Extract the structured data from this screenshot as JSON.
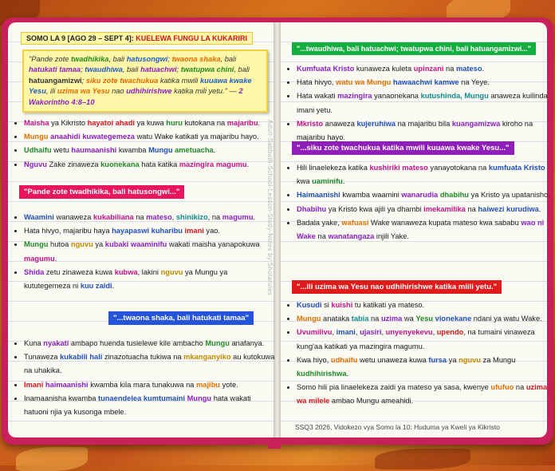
{
  "header": {
    "lesson_tag": "SOMO LA 9 [AGO 29 – SEPT 4]:",
    "lesson_title": "KUELEWA FUNGU LA KUKARIRI"
  },
  "memory_verse": {
    "p1": "\"Pande zote",
    "p2": "twadhikika",
    "p3": ", bali",
    "p4": "hatusongwi",
    "p5": ";",
    "p6": "twaona shaka",
    "p7": ", bali",
    "p8": "hatukati tamaa",
    "p9": ";",
    "p10": "twaudhiwa",
    "p11": ", bali",
    "p12": "hatuachwi",
    "p13": ";",
    "p14": "twatupwa chini",
    "p15": ", bali",
    "p16": "hatuangamizwi",
    "p17": ";",
    "p18": "siku zote twachukua",
    "p19": "katika mwili",
    "p20": "kuuawa kwake Yesu",
    "p21": ", ili",
    "p22": "uzima wa Yesu",
    "p23": "nao",
    "p24": "udhihirishwe",
    "p25": "katika mili yetu.\" —",
    "p26": "2 Wakorintho 4:8–10"
  },
  "left_list_1": [
    {
      "a": "Maisha",
      "b": " ya Kikristo ",
      "c": "hayatoi ahadi",
      "d": " ya kuwa ",
      "e": "huru",
      "f": " kutokana na ",
      "g": "majaribu",
      "h": "."
    },
    {
      "a": "Mungu",
      "b": " ",
      "c": "anaahidi kuwategemeza",
      "d": " watu Wake katikati ya majaribu hayo.",
      "e": "",
      "f": "",
      "g": "",
      "h": ""
    },
    {
      "a": "Udhaifu",
      "b": " wetu ",
      "c": "haumaanishi",
      "d": " kwamba ",
      "e": "Mungu",
      "f": " ",
      "g": "ametuacha",
      "h": "."
    },
    {
      "a": "Nguvu",
      "b": " Zake zinaweza ",
      "c": "kuonekana",
      "d": " hata katika ",
      "e": "mazingira",
      "f": " ",
      "g": "magumu",
      "h": "."
    }
  ],
  "banner_1": "\"Pande zote twadhikika, bali hatusongwi...\"",
  "left_list_2": [
    {
      "a": "Waamini",
      "b": " wanaweza ",
      "c": "kukabiliana",
      "d": " na ",
      "e": "mateso",
      "f": ", ",
      "g": "shinikizo",
      "h": ", na ",
      "i": "magumu",
      "j": "."
    },
    {
      "a": "",
      "b": "Hata hivyo, majaribu haya ",
      "c": "hayapaswi kuharibu",
      "d": " ",
      "e": "imani",
      "f": " yao.",
      "g": "",
      "h": "",
      "i": "",
      "j": ""
    },
    {
      "a": "Mungu",
      "b": " hutoa ",
      "c": "nguvu",
      "d": " ya ",
      "e": "kubaki waaminifu",
      "f": " wakati maisha yanapokuwa ",
      "g": "magumu",
      "h": ".",
      "i": "",
      "j": ""
    },
    {
      "a": "Shida",
      "b": " zetu zinaweza kuwa ",
      "c": "kubwa",
      "d": ", lakini ",
      "e": "nguvu",
      "f": " ya Mungu ya kututegemeza ni ",
      "g": "kuu zaidi",
      "h": ".",
      "i": "",
      "j": ""
    }
  ],
  "banner_2": "\"...twaona shaka, bali hatukati tamaa\"",
  "left_list_3": [
    {
      "a": "",
      "b": "Kuna ",
      "c": "nyakati",
      "d": " ambapo huenda tusielewe kile ambacho ",
      "e": "Mungu",
      "f": " anafanya."
    },
    {
      "a": "",
      "b": "Tunaweza ",
      "c": "kukabili hali",
      "d": " zinazotuacha tukiwa na ",
      "e": "mkanganyiko",
      "f": " au kutokuwa na uhakika."
    },
    {
      "a": "Imani",
      "b": " ",
      "c": "haimaanishi",
      "d": " kwamba kila mara tunakuwa na ",
      "e": "majibu",
      "f": " yote."
    },
    {
      "a": "",
      "b": "Inamaanisha kwamba ",
      "c": "tunaendelea kumtumaini",
      "d": " ",
      "e": "Mungu",
      "f": " hata wakati hatuoni njia ya kusonga mbele."
    }
  ],
  "banner_3": "\"...twaudhiwa, bali hatuachwi; twatupwa chini, bali hatuangamizwi...\"",
  "right_list_1": [
    {
      "a": "Kumfuata Kristo",
      "b": " kunaweza kuleta ",
      "c": "upinzani",
      "d": " na ",
      "e": "mateso",
      "f": "."
    },
    {
      "a": "",
      "b": "Hata hivyo, ",
      "c": "watu wa Mungu",
      "d": " ",
      "e": "hawaachwi kamwe",
      "f": " na Yeye."
    },
    {
      "a": "",
      "b": "Hata wakati ",
      "c": "mazingira",
      "d": " yanaonekana ",
      "e": "kutushinda, Mungu",
      "f": " anaweza kuilinda imani yetu."
    },
    {
      "a": "Mkristo",
      "b": " anaweza ",
      "c": "kujeruhiwa",
      "d": " na majaribu bila ",
      "e": "kuangamizwa",
      "f": " kiroho na majaribu hayo."
    }
  ],
  "banner_4": "\"...siku zote twachukua katika mwili kuuawa kwake Yesu...\"",
  "right_list_2": [
    {
      "a": "",
      "b": "Hili linaelekeza katika ",
      "c": "kushiriki mateso",
      "d": " yanayotokana na ",
      "e": "kumfuata Kristo",
      "f": " kwa ",
      "g": "uaminifu",
      "h": "."
    },
    {
      "a": "Haimaanishi",
      "b": " kwamba waamini ",
      "c": "wanarudia",
      "d": " ",
      "e": "dhabihu",
      "f": " ya Kristo ya upatanisho.",
      "g": "",
      "h": ""
    },
    {
      "a": "Dhabihu",
      "b": " ya Kristo kwa ajili ya dhambi ",
      "c": "imekamilika",
      "d": " na ",
      "e": "haiwezi kurudiwa",
      "f": ".",
      "g": "",
      "h": ""
    },
    {
      "a": "",
      "b": "Badala yake, ",
      "c": "wafuasi",
      "d": " Wake wanaweza kupata mateso kwa sababu ",
      "e": "wao ni Wake",
      "f": " na ",
      "g": "wanatangaza",
      "h": " injili Yake."
    }
  ],
  "banner_5": "\"...ili uzima wa Yesu nao udhihirishwe katika miili yetu.\"",
  "right_list_3": [
    {
      "a": "Kusudi",
      "b": " si ",
      "c": "kuishi",
      "d": " tu katikati ya mateso.",
      "e": "",
      "f": "",
      "g": "",
      "h": "",
      "i": "",
      "j": ""
    },
    {
      "a": "Mungu",
      "b": " anataka ",
      "c": "tabia",
      "d": " na ",
      "e": "uzima",
      "f": " wa ",
      "g": "Yesu",
      "h": " ",
      "i": "vionekane",
      "j": " ndani ya watu Wake."
    },
    {
      "a": "Uvumilivu",
      "b": ", ",
      "c": "imani",
      "d": ", ",
      "e": "ujasiri",
      "f": ", ",
      "g": "unyenyekevu",
      "h": ", ",
      "i": "upendo",
      "j": ", na tumaini vinaweza kung'aa katikati ya mazingira magumu."
    },
    {
      "a": "",
      "b": "Kwa hiyo, ",
      "c": "udhaifu",
      "d": " wetu unaweza kuwa ",
      "e": "fursa",
      "f": " ya ",
      "g": "nguvu",
      "h": " za Mungu ",
      "i": "kudhihirishwa",
      "j": "."
    },
    {
      "a": "",
      "b": "Somo hili pia linaelekeza zaidi ya mateso ya sasa, kwenye ",
      "c": "ufufuo",
      "d": " na ",
      "e": "uzima wa milele",
      "f": " ambao Mungu ameahidi.",
      "g": "",
      "h": "",
      "i": "",
      "j": ""
    }
  ],
  "watermark": "Adult-Sabbath-School-Lesson-Study-Notes by Shotarules",
  "footer": "SSQ3 2026, Vidokezo vya Somo la 10: Huduma ya Kweli ya Kikristo",
  "colors": {
    "cover": "#c8205a",
    "banner_pink": "#e8155f",
    "banner_blue": "#2454d9",
    "banner_green": "#14ad3f",
    "banner_purple": "#8f1fb8",
    "banner_red": "#e01b1b"
  }
}
